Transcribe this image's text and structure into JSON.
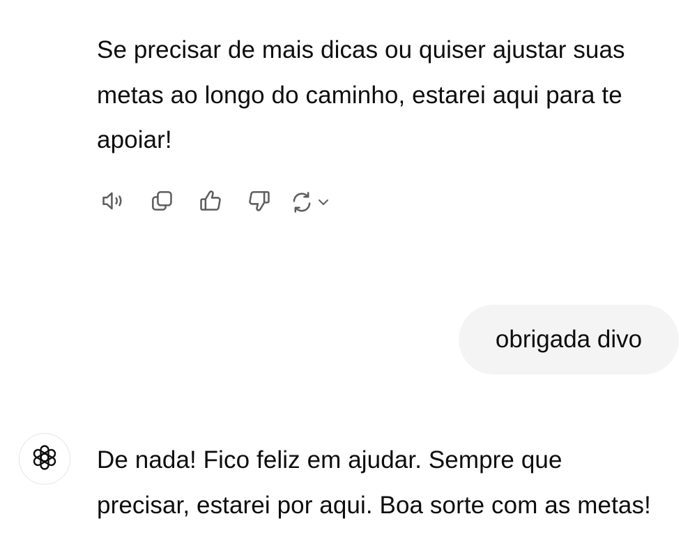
{
  "conversation": {
    "previous_assistant_message": {
      "lines": [
        "Se precisar de mais dicas ou quiser ajustar suas",
        "metas ao longo do caminho, estarei aqui para te",
        "apoiar!"
      ]
    },
    "message_actions": [
      {
        "icon": "speaker-icon",
        "action": "read-aloud"
      },
      {
        "icon": "copy-icon",
        "action": "copy"
      },
      {
        "icon": "thumbs-up-icon",
        "action": "good-response"
      },
      {
        "icon": "thumbs-down-icon",
        "action": "bad-response"
      },
      {
        "icon": "regenerate-icon",
        "action": "regenerate"
      },
      {
        "icon": "chevron-down-icon",
        "action": "regenerate-options"
      }
    ],
    "user_message": {
      "text": "obrigada divo"
    },
    "latest_assistant_message": {
      "avatar_icon": "openai-logo-icon",
      "lines": [
        "De nada! Fico feliz em ajudar. Sempre que",
        "precisar, estarei por aqui. Boa sorte com as metas!"
      ]
    }
  },
  "colors": {
    "background": "#ffffff",
    "text": "#0d0d0d",
    "icon": "#5d5d5d",
    "user_bubble": "#f4f4f4",
    "avatar_border": "#e6e6e6"
  }
}
